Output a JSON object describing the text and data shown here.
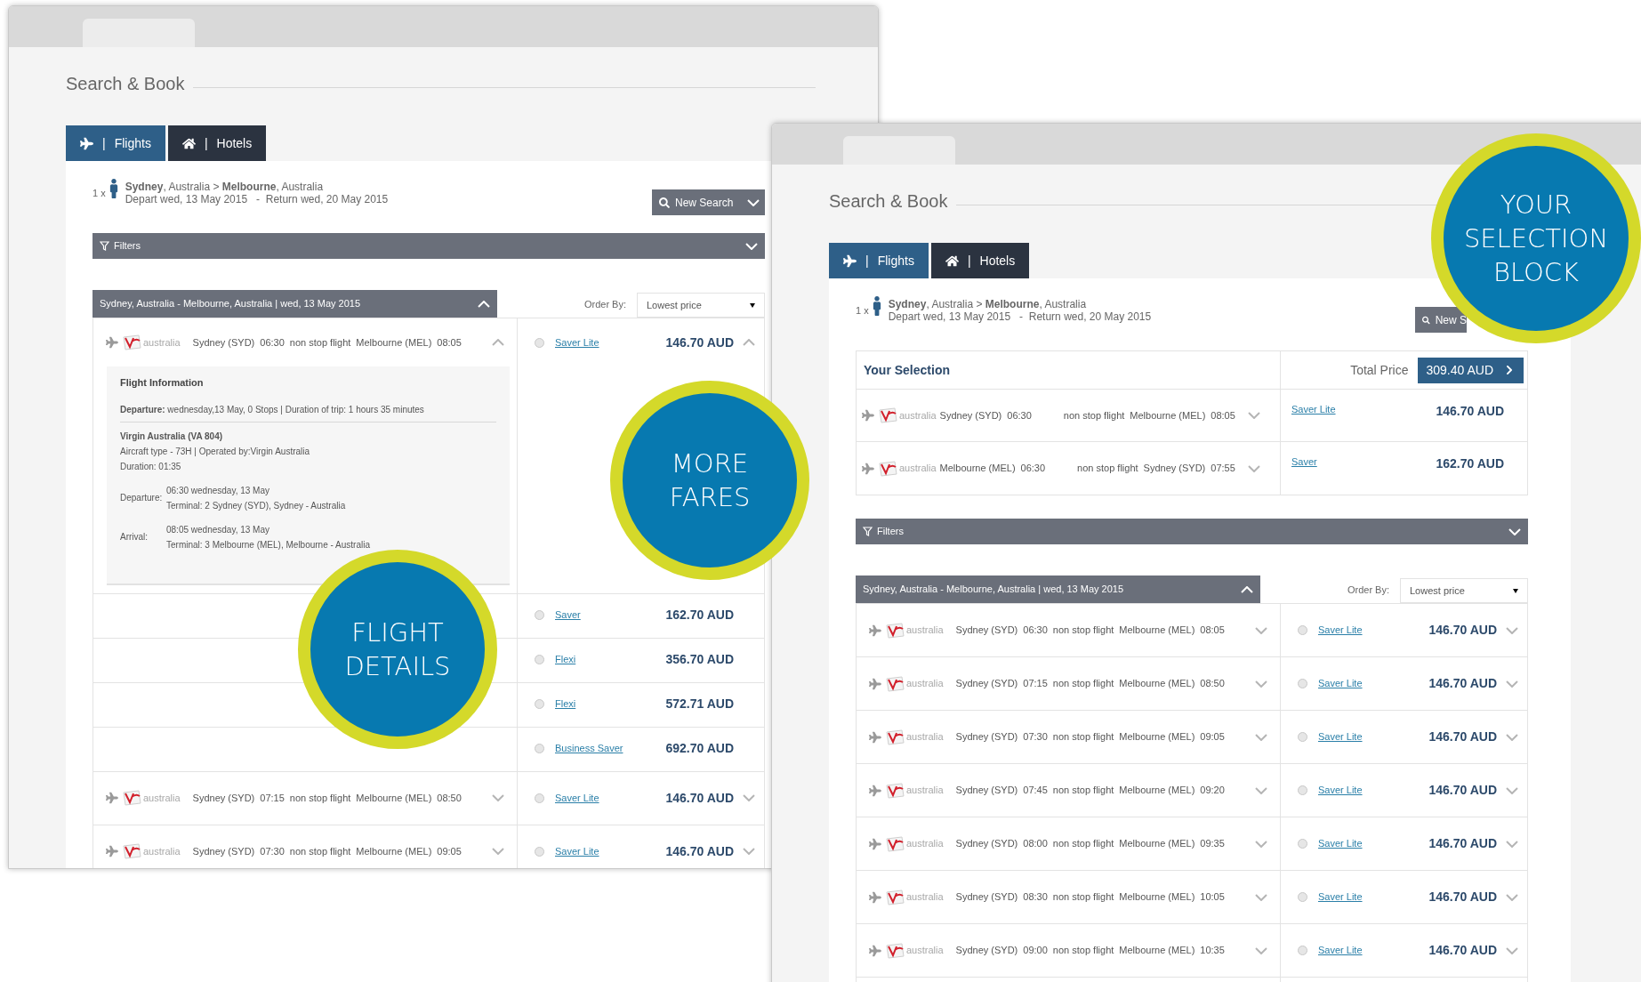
{
  "windows": [
    {
      "title": "Search & Book",
      "tabs": [
        {
          "separator": "|",
          "label": "Flights",
          "selected": true
        },
        {
          "separator": "|",
          "label": "Hotels",
          "selected": false
        }
      ],
      "trip": {
        "passengers": "1 x",
        "route": "**Sydney**, Australia > **Melbourne**, Australia",
        "depart": "Depart wed, 13 May 2015",
        "return": "-  Return wed, 20 May 2015"
      },
      "new_search": "New Search",
      "filters": {
        "label": "Filters",
        "expanded": false
      },
      "group": {
        "title": "Sydney, Australia - Melbourne, Australia | wed, 13 May 2015",
        "expanded": true
      },
      "order_by": {
        "label": "Order By:",
        "value": "Lowest price"
      },
      "flights": [
        {
          "airline": "australia",
          "from": "Sydney (SYD)",
          "dep": "06:30",
          "stop": "non stop flight",
          "to": "Melbourne (MEL)",
          "arr": "08:05",
          "expanded": true,
          "details": {
            "title": "Flight Information",
            "summary": "**Departure:** wednesday,13 May, 0 Stops | Duration of trip: 1 hours 35 minutes",
            "carrier": "Virgin Australia (VA 804)",
            "aircraft": "Aircraft type - 73H | Operated by:Virgin Australia",
            "duration": "Duration: 01:35",
            "legs": [
              {
                "label": "Departure:",
                "time": "06:30 wednesday, 13 May",
                "terminal": "Terminal: 2 Sydney (SYD), Sydney - Australia"
              },
              {
                "label": "Arrival:",
                "time": "08:05 wednesday, 13 May",
                "terminal": "Terminal: 3 Melbourne (MEL), Melbourne - Australia"
              }
            ]
          },
          "fares": [
            {
              "name": "Saver Lite",
              "price": "146.70 AUD",
              "selected": false
            },
            {
              "name": "Saver",
              "price": "162.70 AUD",
              "selected": false
            },
            {
              "name": "Flexi",
              "price": "356.70 AUD",
              "selected": false
            },
            {
              "name": "Flexi",
              "price": "572.71 AUD",
              "selected": false
            },
            {
              "name": "Business Saver",
              "price": "692.70 AUD",
              "selected": false
            }
          ]
        },
        {
          "airline": "australia",
          "from": "Sydney (SYD)",
          "dep": "07:15",
          "stop": "non stop flight",
          "to": "Melbourne (MEL)",
          "arr": "08:50",
          "expanded": false,
          "fares": [
            {
              "name": "Saver Lite",
              "price": "146.70 AUD",
              "selected": false
            }
          ]
        },
        {
          "airline": "australia",
          "from": "Sydney (SYD)",
          "dep": "07:30",
          "stop": "non stop flight",
          "to": "Melbourne (MEL)",
          "arr": "09:05",
          "expanded": false,
          "fares": [
            {
              "name": "Saver Lite",
              "price": "146.70 AUD",
              "selected": false
            }
          ]
        }
      ]
    },
    {
      "title": "Search & Book",
      "tabs": [
        {
          "separator": "|",
          "label": "Flights",
          "selected": true
        },
        {
          "separator": "|",
          "label": "Hotels",
          "selected": false
        }
      ],
      "trip": {
        "passengers": "1 x",
        "route": "**Sydney**, Australia > **Melbourne**, Australia",
        "depart": "Depart wed, 13 May 2015",
        "return": "-  Return wed, 20 May 2015"
      },
      "new_search": "New S",
      "selection": {
        "title": "Your Selection",
        "total_label": "Total Price",
        "total": "309.40 AUD",
        "items": [
          {
            "airline": "australia",
            "from": "Sydney (SYD)",
            "dep": "06:30",
            "stop": "non stop flight",
            "to": "Melbourne (MEL)",
            "arr": "08:05",
            "expanded": false,
            "fare": "Saver Lite",
            "price": "146.70 AUD"
          },
          {
            "airline": "australia",
            "from": "Melbourne (MEL)",
            "dep": "06:30",
            "stop": "non stop flight",
            "to": "Sydney (SYD)",
            "arr": "07:55",
            "expanded": false,
            "fare": "Saver",
            "price": "162.70 AUD"
          }
        ]
      },
      "filters": {
        "label": "Filters",
        "expanded": false
      },
      "group": {
        "title": "Sydney, Australia - Melbourne, Australia | wed, 13 May 2015",
        "expanded": true
      },
      "order_by": {
        "label": "Order By:",
        "value": "Lowest price"
      },
      "flights": [
        {
          "airline": "australia",
          "from": "Sydney (SYD)",
          "dep": "06:30",
          "stop": "non stop flight",
          "to": "Melbourne (MEL)",
          "arr": "08:05",
          "expanded": false,
          "fares": [
            {
              "name": "Saver Lite",
              "price": "146.70 AUD",
              "selected": false
            }
          ]
        },
        {
          "airline": "australia",
          "from": "Sydney (SYD)",
          "dep": "07:15",
          "stop": "non stop flight",
          "to": "Melbourne (MEL)",
          "arr": "08:50",
          "expanded": false,
          "fares": [
            {
              "name": "Saver Lite",
              "price": "146.70 AUD",
              "selected": false
            }
          ]
        },
        {
          "airline": "australia",
          "from": "Sydney (SYD)",
          "dep": "07:30",
          "stop": "non stop flight",
          "to": "Melbourne (MEL)",
          "arr": "09:05",
          "expanded": false,
          "fares": [
            {
              "name": "Saver Lite",
              "price": "146.70 AUD",
              "selected": false
            }
          ]
        },
        {
          "airline": "australia",
          "from": "Sydney (SYD)",
          "dep": "07:45",
          "stop": "non stop flight",
          "to": "Melbourne (MEL)",
          "arr": "09:20",
          "expanded": false,
          "fares": [
            {
              "name": "Saver Lite",
              "price": "146.70 AUD",
              "selected": false
            }
          ]
        },
        {
          "airline": "australia",
          "from": "Sydney (SYD)",
          "dep": "08:00",
          "stop": "non stop flight",
          "to": "Melbourne (MEL)",
          "arr": "09:35",
          "expanded": false,
          "fares": [
            {
              "name": "Saver Lite",
              "price": "146.70 AUD",
              "selected": false
            }
          ]
        },
        {
          "airline": "australia",
          "from": "Sydney (SYD)",
          "dep": "08:30",
          "stop": "non stop flight",
          "to": "Melbourne (MEL)",
          "arr": "10:05",
          "expanded": false,
          "fares": [
            {
              "name": "Saver Lite",
              "price": "146.70 AUD",
              "selected": false
            }
          ]
        },
        {
          "airline": "australia",
          "from": "Sydney (SYD)",
          "dep": "09:00",
          "stop": "non stop flight",
          "to": "Melbourne (MEL)",
          "arr": "10:35",
          "expanded": false,
          "fares": [
            {
              "name": "Saver Lite",
              "price": "146.70 AUD",
              "selected": false
            }
          ]
        }
      ]
    }
  ],
  "callouts": [
    {
      "lines": [
        "MORE",
        "FARES"
      ]
    },
    {
      "lines": [
        "FLIGHT",
        "DETAILS"
      ]
    },
    {
      "lines": [
        "YOUR",
        "SELECTION",
        "BLOCK"
      ]
    }
  ]
}
